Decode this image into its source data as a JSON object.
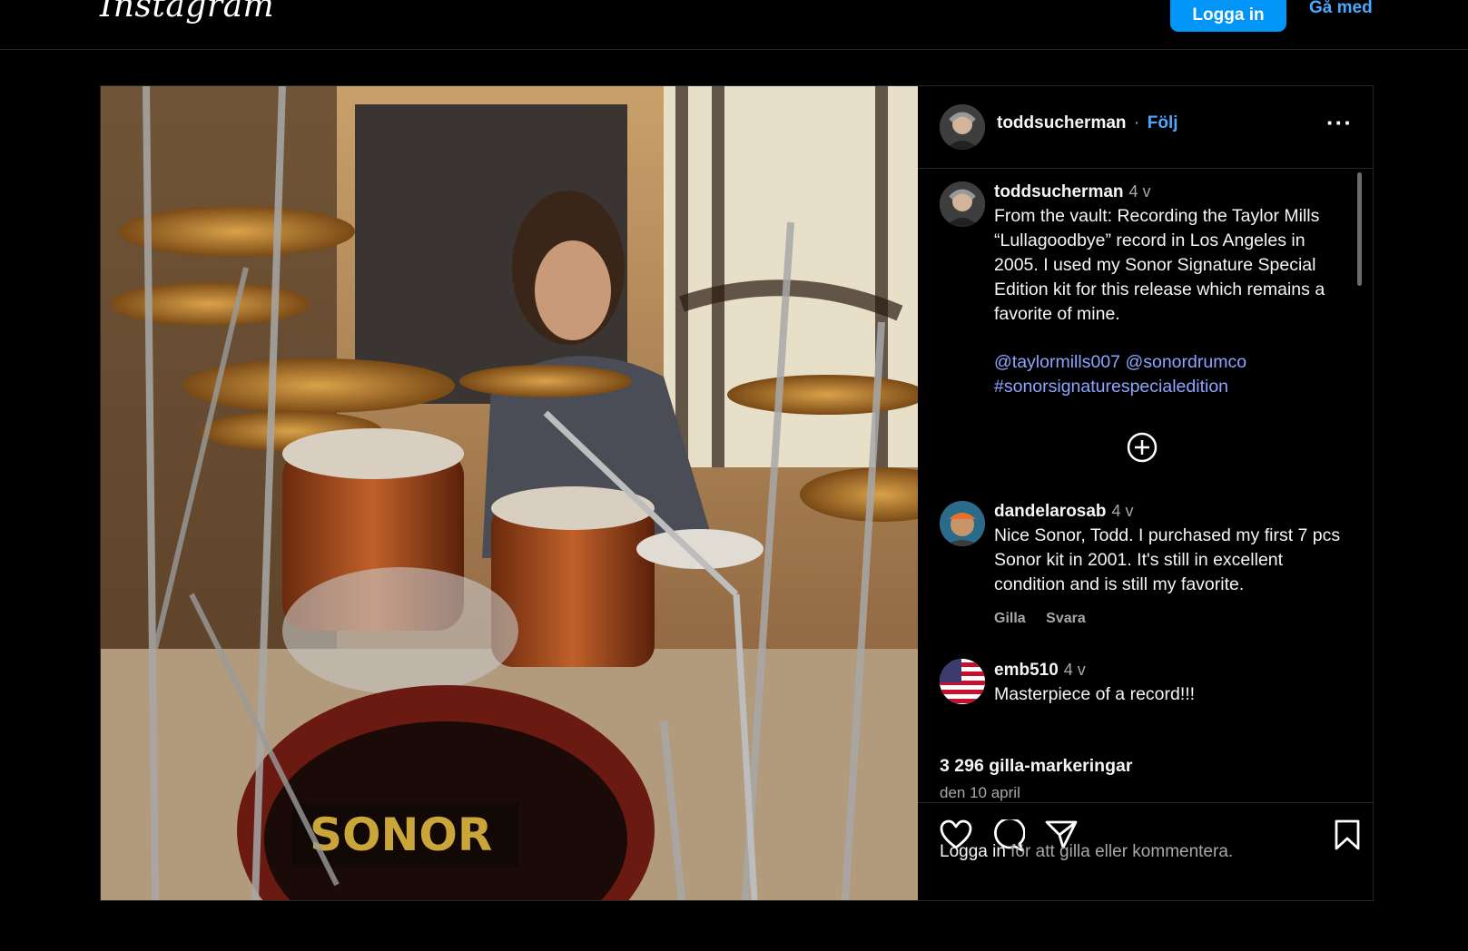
{
  "header": {
    "logo_text": "Instagram",
    "login_label": "Logga in",
    "join_label": "Gå med"
  },
  "post": {
    "username": "toddsucherman",
    "follow_label": "Följ",
    "separator": "·",
    "more_label": "···",
    "caption": {
      "username": "toddsucherman",
      "time": "4 v",
      "text": "From the vault: Recording the Taylor Mills “Lullagoodbye” record in Los Angeles in 2005. I used my Sonor Signature Special Edition kit for this release which remains a favorite of mine.",
      "mention_1": "@taylormills007",
      "mention_2": "@sonordrumco",
      "hashtag": "#sonorsignaturespecialedition"
    },
    "comments": [
      {
        "username": "dandelarosab",
        "time": "4 v",
        "text": "Nice Sonor, Todd. I purchased my first 7 pcs Sonor kit in 2001. It's still in excellent condition and is still my favorite.",
        "like_label": "Gilla",
        "reply_label": "Svara"
      },
      {
        "username": "emb510",
        "time": "4 v",
        "text": "Masterpiece of a record!!!"
      }
    ],
    "likes": "3 296 gilla-markeringar",
    "date": "den 10 april",
    "login_prompt_link": "Logga in",
    "login_prompt_rest": " för att gilla eller kommentera.",
    "photo_brand_text": "SONOR"
  },
  "icons": [
    "heart-icon",
    "comment-icon",
    "share-icon",
    "bookmark-icon",
    "plus-circle-icon",
    "more-icon"
  ],
  "colors": {
    "accent": "#0095f6",
    "link": "#4aa8ff",
    "tag": "#8fa4ff",
    "background": "#000000"
  }
}
